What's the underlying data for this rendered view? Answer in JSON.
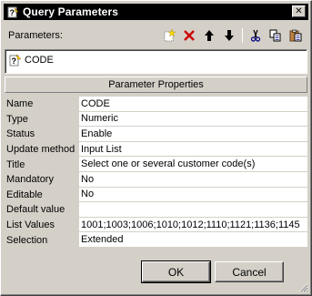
{
  "window": {
    "title": "Query Parameters",
    "close_label": "✕"
  },
  "parameters": {
    "label": "Parameters:",
    "toolbar": [
      {
        "name": "new-parameter",
        "icon": "new-icon"
      },
      {
        "name": "delete-parameter",
        "icon": "delete-icon"
      },
      {
        "name": "move-up",
        "icon": "arrow-up-icon"
      },
      {
        "name": "move-down",
        "icon": "arrow-down-icon"
      },
      {
        "name": "cut",
        "icon": "scissors-icon"
      },
      {
        "name": "copy",
        "icon": "copy-icon"
      },
      {
        "name": "paste",
        "icon": "paste-icon"
      }
    ],
    "items": [
      {
        "label": "CODE",
        "icon": "parameter-icon"
      }
    ]
  },
  "properties": {
    "header": "Parameter Properties",
    "rows": [
      {
        "label": "Name",
        "value": "CODE"
      },
      {
        "label": "Type",
        "value": "Numeric"
      },
      {
        "label": "Status",
        "value": "Enable"
      },
      {
        "label": "Update method",
        "value": "Input List"
      },
      {
        "label": "Title",
        "value": "Select one or several customer code(s)"
      },
      {
        "label": "Mandatory",
        "value": "No"
      },
      {
        "label": "Editable",
        "value": "No"
      },
      {
        "label": "Default value",
        "value": ""
      },
      {
        "label": "List Values",
        "value": "1001;1003;1006;1010;1012;1110;1121;1136;1145"
      },
      {
        "label": "Selection",
        "value": "Extended"
      }
    ]
  },
  "buttons": {
    "ok": "OK",
    "cancel": "Cancel"
  },
  "colors": {
    "titlebar": "#000000",
    "face": "#d4d0c8",
    "delete_red": "#cc0000"
  }
}
